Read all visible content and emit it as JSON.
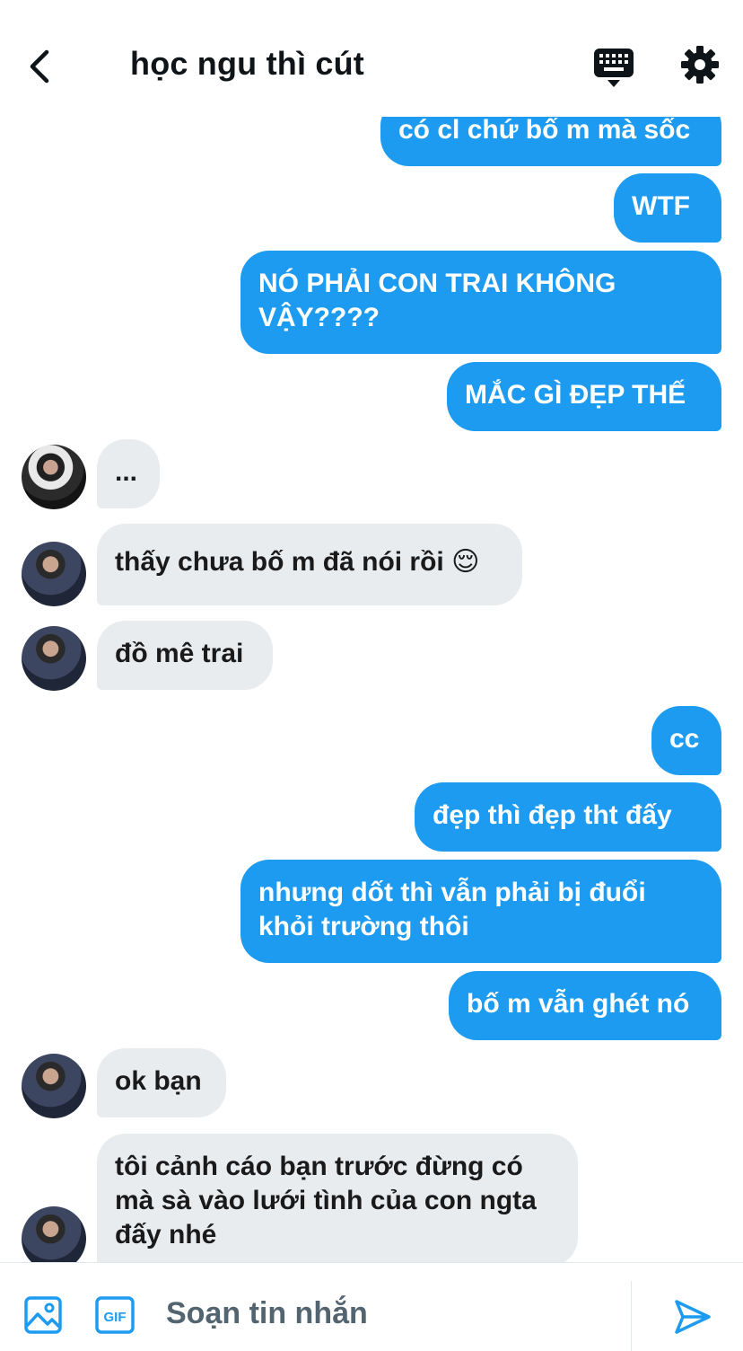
{
  "header": {
    "title": "học ngu thì cút"
  },
  "messages": [
    {
      "from": "me",
      "text": "có cl chứ bố m mà sốc"
    },
    {
      "from": "me",
      "text": "WTF"
    },
    {
      "from": "me",
      "text": "NÓ PHẢI CON TRAI KHÔNG\nVẬY????"
    },
    {
      "from": "me",
      "text": "MẮC GÌ ĐẸP THẾ"
    },
    {
      "from": "them",
      "text": "..."
    },
    {
      "from": "them",
      "text": "thấy chưa bố m đã nói rồi 😌"
    },
    {
      "from": "them",
      "text": "đồ mê trai"
    },
    {
      "from": "me",
      "text": "cc"
    },
    {
      "from": "me",
      "text": "đẹp thì đẹp tht đấy"
    },
    {
      "from": "me",
      "text": "nhưng dốt thì vẫn phải bị đuổi\nkhỏi trường thôi"
    },
    {
      "from": "me",
      "text": "bố m vẫn ghét nó"
    },
    {
      "from": "them",
      "text": "ok bạn"
    },
    {
      "from": "them",
      "text": "tôi cảnh cáo bạn trước đừng có\nmà sà vào lưới tình của con ngta\nđấy nhé"
    }
  ],
  "composer": {
    "placeholder": "Soạn tin nhắn"
  },
  "colors": {
    "accent": "#1d9bf0",
    "incoming_bubble": "#e9ecef"
  }
}
